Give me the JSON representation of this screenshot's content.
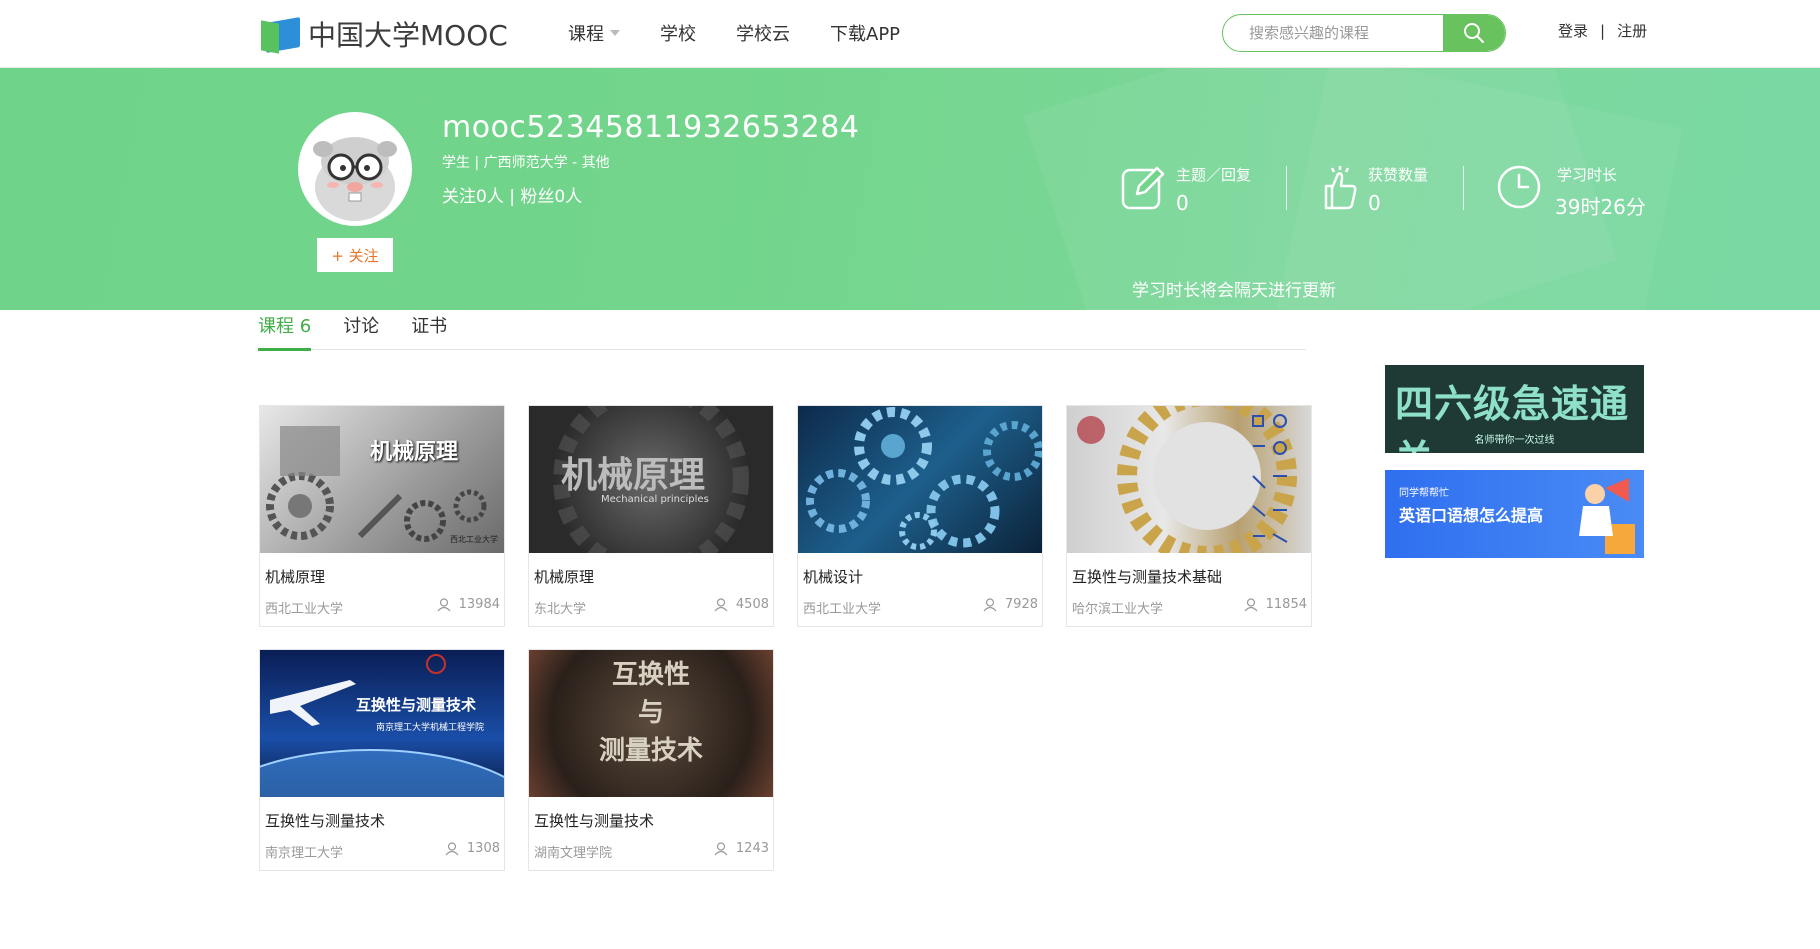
{
  "header": {
    "logo_text": "中国大学MOOC",
    "nav": [
      "课程",
      "学校",
      "学校云",
      "下载APP"
    ],
    "search_placeholder": "搜索感兴趣的课程",
    "login": "登录",
    "separator": "|",
    "register": "注册"
  },
  "profile": {
    "username": "mooc52345811932653284",
    "info": "学生 | 广西师范大学 - 其他",
    "follows": "关注0人 | 粉丝0人",
    "follow_button": "+ 关注",
    "stats": [
      {
        "label": "主题／回复",
        "value": "0",
        "icon": "edit-icon"
      },
      {
        "label": "获赞数量",
        "value": "0",
        "icon": "thumbs-up-icon"
      },
      {
        "label": "学习时长",
        "value": "39时26分",
        "icon": "clock-icon"
      }
    ],
    "update_note": "学习时长将会隔天进行更新"
  },
  "tabs": [
    {
      "label": "课程 6",
      "active": true
    },
    {
      "label": "讨论",
      "active": false
    },
    {
      "label": "证书",
      "active": false
    }
  ],
  "courses": [
    {
      "title": "机械原理",
      "school": "西北工业大学",
      "count": "13984",
      "thumb_text": "机械原理",
      "thumb_sub": "西北工业大学"
    },
    {
      "title": "机械原理",
      "school": "东北大学",
      "count": "4508",
      "thumb_text": "机械原理",
      "thumb_sub": "Mechanical principles"
    },
    {
      "title": "机械设计",
      "school": "西北工业大学",
      "count": "7928",
      "thumb_text": "",
      "thumb_sub": ""
    },
    {
      "title": "互换性与测量技术基础",
      "school": "哈尔滨工业大学",
      "count": "11854",
      "thumb_text": "",
      "thumb_sub": ""
    },
    {
      "title": "互换性与测量技术",
      "school": "南京理工大学",
      "count": "1308",
      "thumb_text": "互换性与测量技术",
      "thumb_sub": "南京理工大学机械工程学院"
    },
    {
      "title": "互换性与测量技术",
      "school": "湖南文理学院",
      "count": "1243",
      "thumb_text": "互换性\n与\n测量技术",
      "thumb_sub": ""
    }
  ],
  "ads": [
    {
      "title": "四六级急速通关",
      "subtitle": "名师带你一次过线"
    },
    {
      "title": "英语口语想怎么提高",
      "subtitle": "同学帮帮忙"
    }
  ],
  "colors": {
    "brand_green": "#3fae48",
    "banner_green": "#72d58b",
    "follow_orange": "#e8742a"
  }
}
